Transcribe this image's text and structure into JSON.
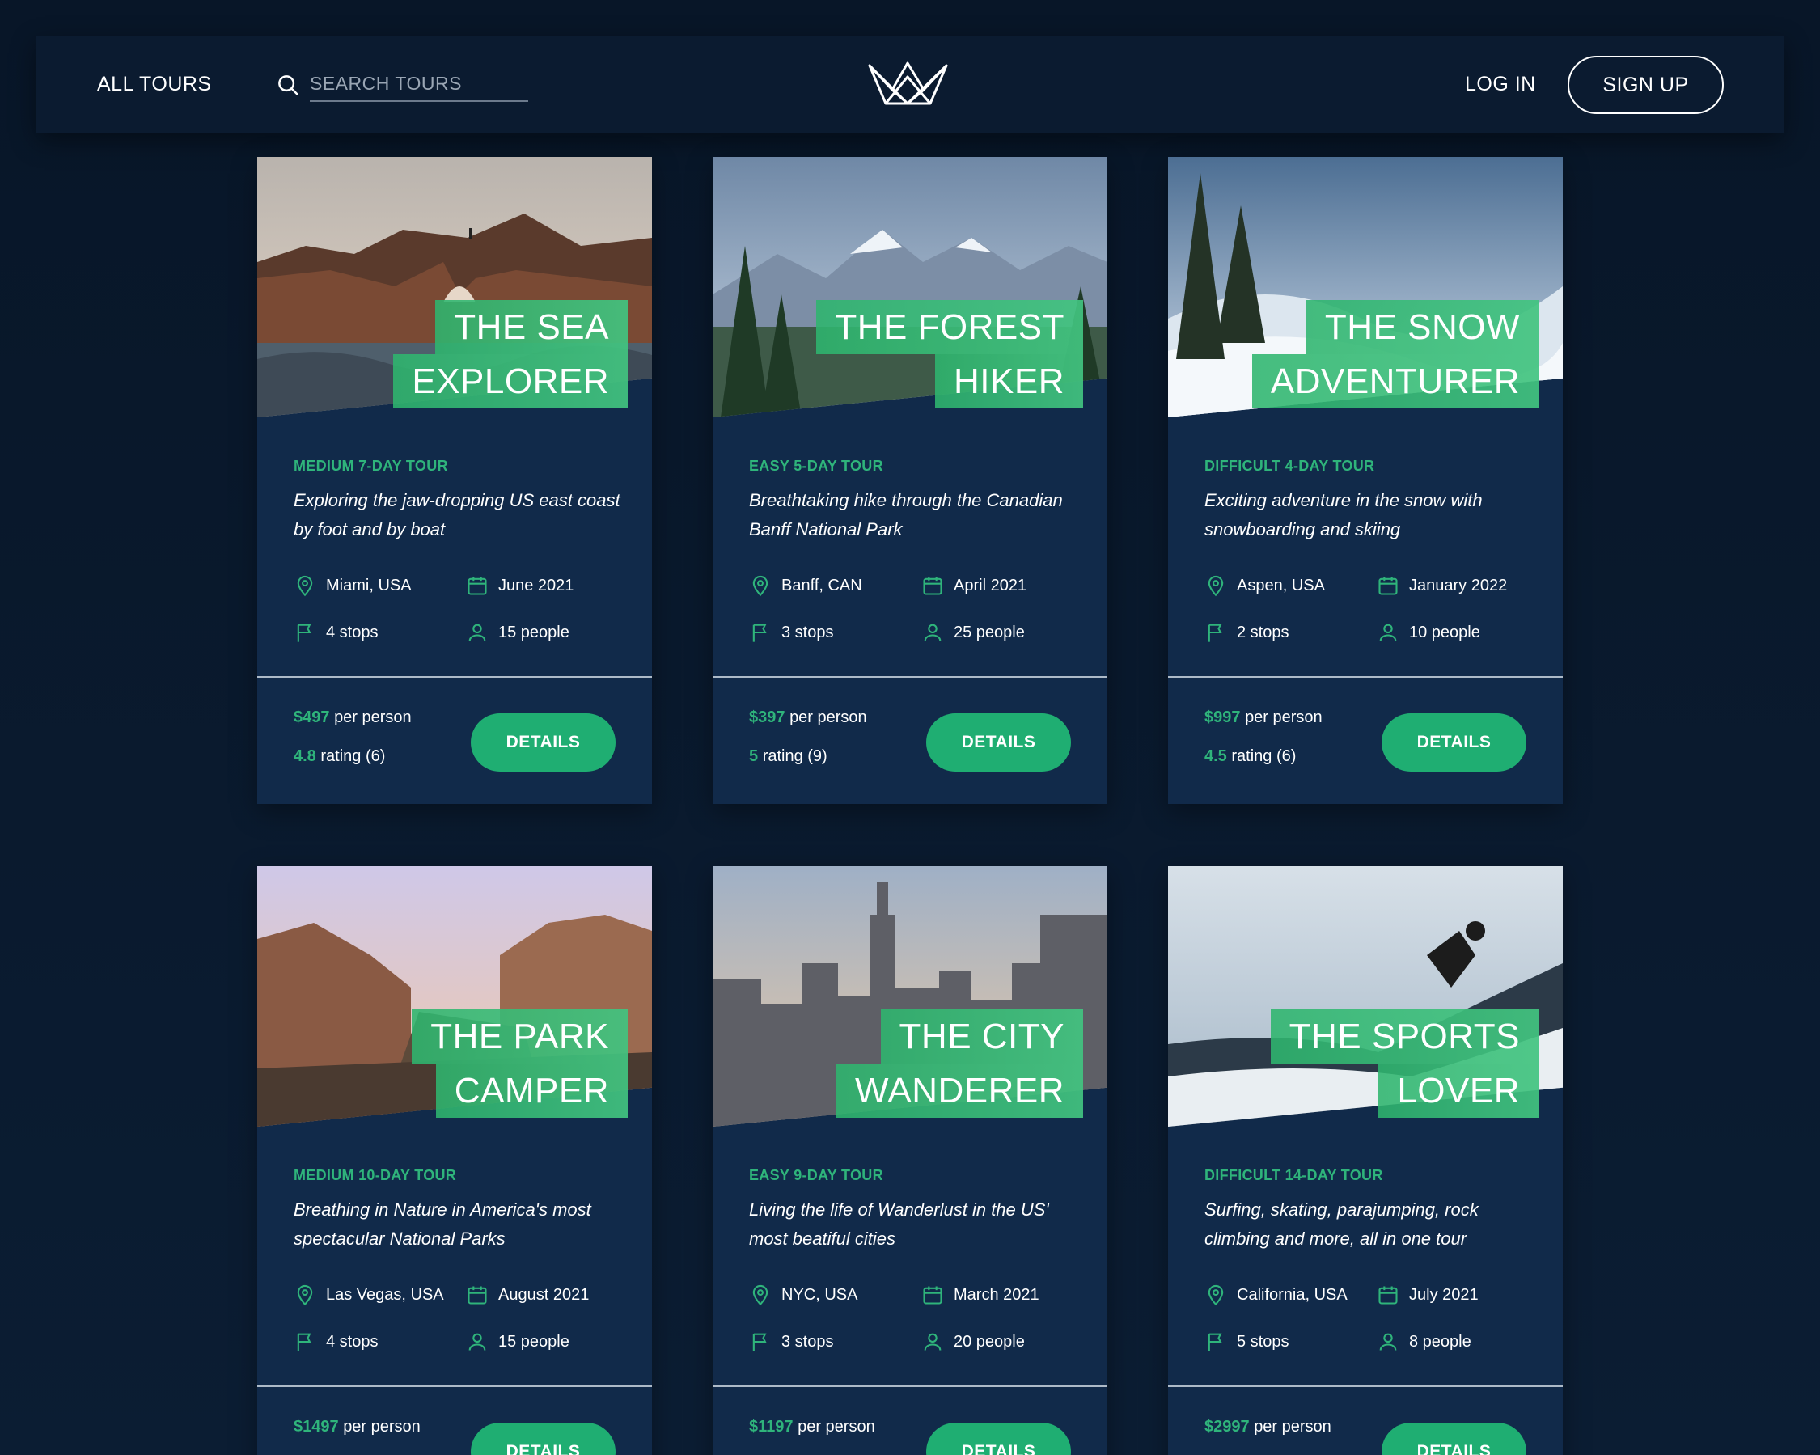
{
  "header": {
    "all_tours": "ALL TOURS",
    "search_placeholder": "SEARCH TOURS",
    "login": "LOG IN",
    "signup": "SIGN UP"
  },
  "colors": {
    "accent": "#2fb47b",
    "card": "#112a4a",
    "background": "#0a1a2e"
  },
  "tours": [
    {
      "title_line1": "THE SEA",
      "title_line2": "EXPLORER",
      "tag": "MEDIUM 7-DAY TOUR",
      "description": "Exploring the jaw-dropping US east coast by foot and by boat",
      "location": "Miami, USA",
      "date": "June 2021",
      "stops": "4 stops",
      "people": "15 people",
      "price": "$497",
      "price_suffix": "per person",
      "rating": "4.8",
      "rating_suffix": "rating (6)",
      "details": "DETAILS"
    },
    {
      "title_line1": "THE FOREST",
      "title_line2": "HIKER",
      "tag": "EASY 5-DAY TOUR",
      "description": "Breathtaking hike through the Canadian Banff National Park",
      "location": "Banff, CAN",
      "date": "April 2021",
      "stops": "3 stops",
      "people": "25 people",
      "price": "$397",
      "price_suffix": "per person",
      "rating": "5",
      "rating_suffix": "rating (9)",
      "details": "DETAILS"
    },
    {
      "title_line1": "THE SNOW",
      "title_line2": "ADVENTURER",
      "tag": "DIFFICULT 4-DAY TOUR",
      "description": "Exciting adventure in the snow with snowboarding and skiing",
      "location": "Aspen, USA",
      "date": "January 2022",
      "stops": "2 stops",
      "people": "10 people",
      "price": "$997",
      "price_suffix": "per person",
      "rating": "4.5",
      "rating_suffix": "rating (6)",
      "details": "DETAILS"
    },
    {
      "title_line1": "THE PARK",
      "title_line2": "CAMPER",
      "tag": "MEDIUM 10-DAY TOUR",
      "description": "Breathing in Nature in America's most spectacular National Parks",
      "location": "Las Vegas, USA",
      "date": "August 2021",
      "stops": "4 stops",
      "people": "15 people",
      "price": "$1497",
      "price_suffix": "per person",
      "rating": "",
      "rating_suffix": "",
      "details": "DETAILS"
    },
    {
      "title_line1": "THE CITY",
      "title_line2": "WANDERER",
      "tag": "EASY 9-DAY TOUR",
      "description": "Living the life of Wanderlust in the US' most beatiful cities",
      "location": "NYC, USA",
      "date": "March 2021",
      "stops": "3 stops",
      "people": "20 people",
      "price": "$1197",
      "price_suffix": "per person",
      "rating": "",
      "rating_suffix": "",
      "details": "DETAILS"
    },
    {
      "title_line1": "THE SPORTS",
      "title_line2": "LOVER",
      "tag": "DIFFICULT 14-DAY TOUR",
      "description": "Surfing, skating, parajumping, rock climbing and more, all in one tour",
      "location": "California, USA",
      "date": "July 2021",
      "stops": "5 stops",
      "people": "8 people",
      "price": "$2997",
      "price_suffix": "per person",
      "rating": "",
      "rating_suffix": "",
      "details": "DETAILS"
    }
  ]
}
